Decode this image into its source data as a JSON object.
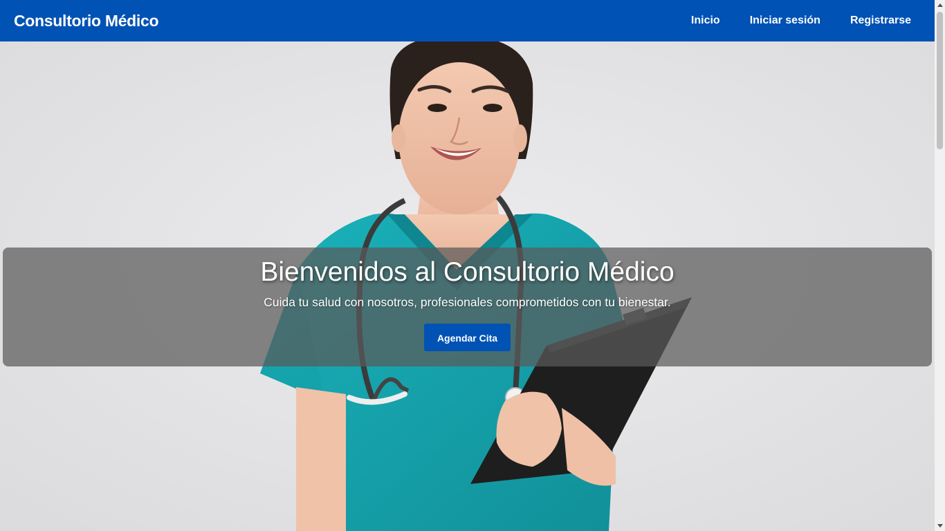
{
  "navbar": {
    "brand": "Consultorio Médico",
    "links": [
      {
        "label": "Inicio"
      },
      {
        "label": "Iniciar sesión"
      },
      {
        "label": "Registrarse"
      }
    ]
  },
  "hero": {
    "title": "Bienvenidos al Consultorio Médico",
    "subtitle": "Cuida tu salud con nosotros, profesionales comprometidos con tu bienestar.",
    "cta_label": "Agendar Cita"
  },
  "colors": {
    "primary": "#0052b4",
    "background": "#e4e4e6",
    "scrubs": "#17a3ac",
    "overlay": "#5a5a5a"
  },
  "icons": {
    "scroll_up": "chevron-up-icon",
    "scroll_down": "chevron-down-icon"
  }
}
